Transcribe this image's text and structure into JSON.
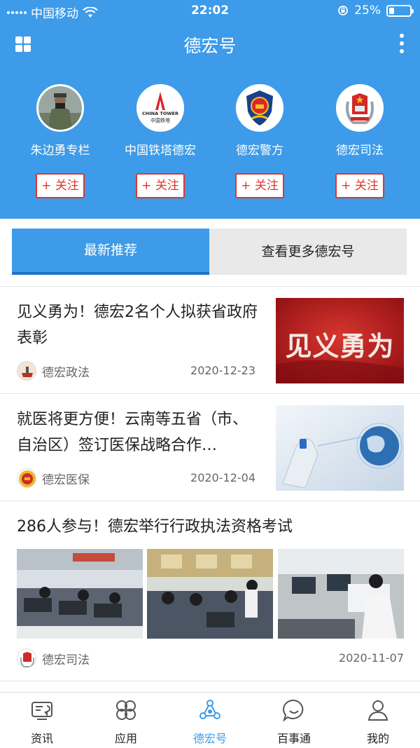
{
  "status_bar": {
    "carrier": "中国移动",
    "time": "22:02",
    "battery": "25%"
  },
  "header": {
    "title": "德宏号"
  },
  "accounts": [
    {
      "name": "朱边勇专栏",
      "follow": "+ 关注"
    },
    {
      "name": "中国铁塔德宏",
      "follow": "+ 关注",
      "logo_text": "CHINA TOWER",
      "logo_sub": "中国铁塔"
    },
    {
      "name": "德宏警方",
      "follow": "+ 关注"
    },
    {
      "name": "德宏司法",
      "follow": "+ 关注"
    }
  ],
  "tabs": [
    {
      "label": "最新推荐",
      "active": true
    },
    {
      "label": "查看更多德宏号",
      "active": false
    }
  ],
  "news": [
    {
      "title": "见义勇为！德宏2名个人拟获省政府表彰",
      "source": "德宏政法",
      "date": "2020-12-23",
      "thumb_text": "见义勇为"
    },
    {
      "title": "就医将更方便！云南等五省（市、自治区）签订医保战略合作…",
      "source": "德宏医保",
      "date": "2020-12-04"
    },
    {
      "title": "286人参与！德宏举行行政执法资格考试",
      "source": "德宏司法",
      "date": "2020-11-07"
    }
  ],
  "tabbar": [
    {
      "label": "资讯",
      "icon": "news-screen-icon"
    },
    {
      "label": "应用",
      "icon": "apps-clover-icon"
    },
    {
      "label": "德宏号",
      "icon": "share-hub-icon",
      "active": true
    },
    {
      "label": "百事通",
      "icon": "chat-bubble-icon"
    },
    {
      "label": "我的",
      "icon": "person-icon"
    }
  ],
  "colors": {
    "brand_blue": "#3d9be9",
    "follow_red": "#e0362f",
    "tab_active_border": "#1e73c8"
  }
}
